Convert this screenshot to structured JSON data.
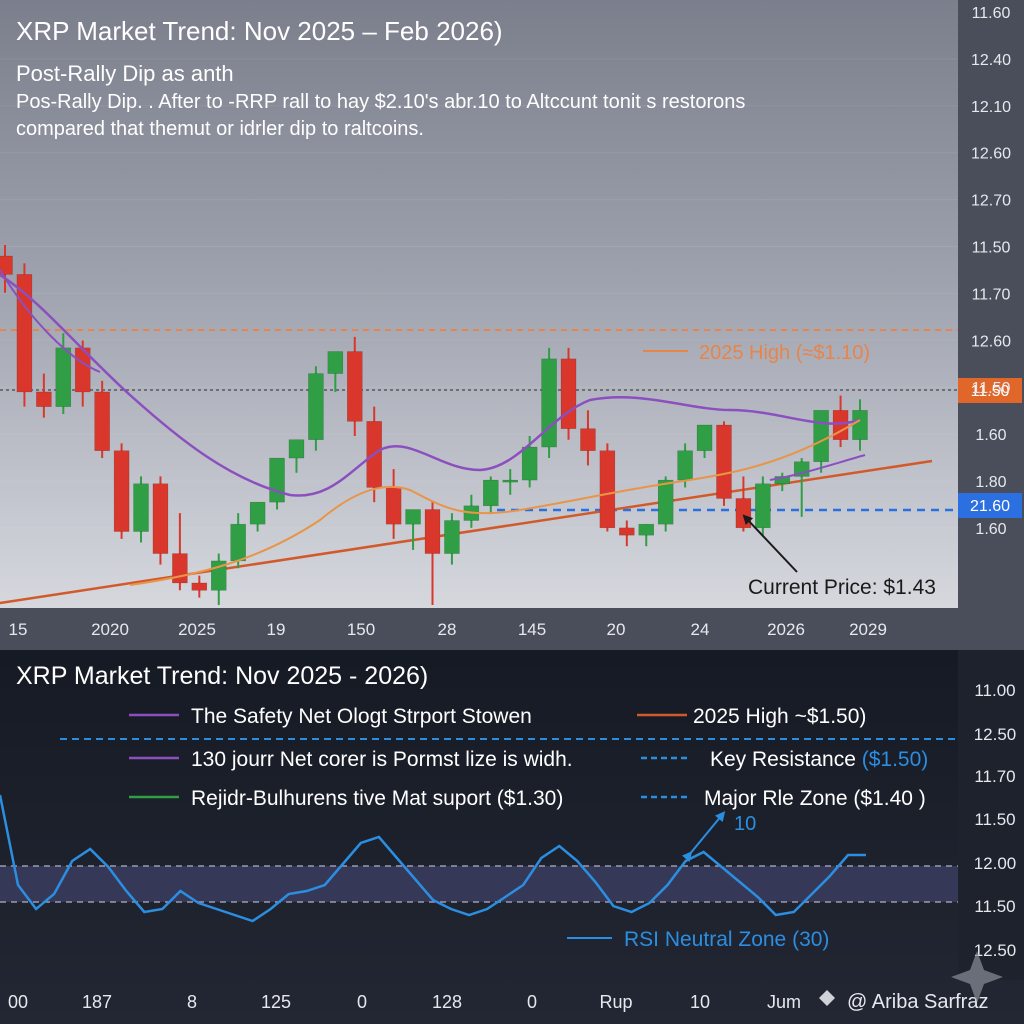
{
  "colors": {
    "up": "#2f9e44",
    "down": "#d9372b",
    "sma": "#8b4fc0",
    "ema": "#e8954a",
    "trend": "#d25a2a",
    "resistance": "#e8844a",
    "support": "#2b6fe0",
    "rsi": "#2b8ee0",
    "price_tag": "#e0662a",
    "support_tag": "#2b6fe0"
  },
  "header": {
    "title": "XRP Market Trend: Nov 2025 – Feb 2026)",
    "subtitle": "Post-Rally Dip as anth",
    "description_line1": "Pos-Rally Dip. . After to -RRP rall to hay $2.10's abr.10 to Altccunt tonit  s restorons",
    "description_line2": "compared that themut or idrler dip to raltcoins."
  },
  "chart_data": [
    {
      "type": "candlestick",
      "title": "XRP Market Trend: Nov 2025 – Feb 2026)",
      "x_tick_labels": [
        "15",
        "2020",
        "2025",
        "19",
        "150",
        "28",
        "145",
        "20",
        "24",
        "2026",
        "2029"
      ],
      "y_tick_labels": [
        "11.60",
        "12.40",
        "12.10",
        "12.60",
        "12.70",
        "11.50",
        "11.70",
        "12.60",
        "11.50",
        "1.60",
        "1.80",
        "1.60"
      ],
      "ohlc": [
        [
          93,
          96,
          83,
          88
        ],
        [
          88,
          91,
          52,
          56
        ],
        [
          56,
          61,
          49,
          52
        ],
        [
          52,
          72,
          50,
          68
        ],
        [
          68,
          70,
          52,
          56
        ],
        [
          56,
          59,
          38,
          40
        ],
        [
          40,
          42,
          16,
          18
        ],
        [
          18,
          33,
          15,
          31
        ],
        [
          31,
          33,
          9,
          12
        ],
        [
          12,
          23,
          2,
          4
        ],
        [
          4,
          6,
          0,
          2
        ],
        [
          2,
          12,
          -2,
          10
        ],
        [
          10,
          23,
          8,
          20
        ],
        [
          20,
          26,
          18,
          26
        ],
        [
          26,
          36,
          24,
          38
        ],
        [
          38,
          43,
          34,
          43
        ],
        [
          43,
          63,
          40,
          61
        ],
        [
          61,
          67,
          56,
          67
        ],
        [
          67,
          71,
          44,
          48
        ],
        [
          48,
          52,
          26,
          30
        ],
        [
          30,
          35,
          16,
          20
        ],
        [
          20,
          22,
          13,
          24
        ],
        [
          24,
          26,
          -2,
          12
        ],
        [
          12,
          23,
          9,
          21
        ],
        [
          21,
          28,
          19,
          25
        ],
        [
          25,
          33,
          23,
          32
        ],
        [
          32,
          35,
          28,
          32
        ],
        [
          32,
          44,
          30,
          41
        ],
        [
          41,
          68,
          38,
          65
        ],
        [
          65,
          68,
          43,
          46
        ],
        [
          46,
          51,
          36,
          40
        ],
        [
          40,
          42,
          18,
          19
        ],
        [
          19,
          21,
          14,
          17
        ],
        [
          17,
          20,
          14,
          20
        ],
        [
          20,
          33,
          18,
          32
        ],
        [
          32,
          42,
          30,
          40
        ],
        [
          40,
          47,
          38,
          47
        ],
        [
          47,
          48,
          25,
          27
        ],
        [
          27,
          33,
          18,
          19
        ],
        [
          19,
          33,
          17,
          31
        ],
        [
          31,
          34,
          29,
          33
        ],
        [
          33,
          38,
          22,
          37
        ],
        [
          37,
          48,
          34,
          51
        ],
        [
          51,
          55,
          41,
          43
        ],
        [
          43,
          54,
          40,
          51
        ]
      ],
      "sma_label": "The Safety Net Ologt Strport Stowen",
      "annotations": {
        "resistance_label": "2025 High (≈$1.10)",
        "current_price_label": "Current Price: $1.43",
        "price_tag": "11.50",
        "support_tag": "21.60"
      }
    },
    {
      "type": "line",
      "title": "XRP Market Trend: Nov 2025 - 2026)",
      "x_tick_labels": [
        "00",
        "187",
        "8",
        "125",
        "0",
        "128",
        "0",
        "Rup",
        "10",
        "Jum",
        "@ Ariba Sarfraz"
      ],
      "y_tick_labels": [
        "11.00",
        "12.50",
        "11.70",
        "11.50",
        "12.00",
        "11.50",
        "12.50"
      ],
      "series": [
        {
          "values": [
            1.6,
            1.3,
            1.22,
            1.27,
            1.38,
            1.42,
            1.36,
            1.28,
            1.21,
            1.22,
            1.28,
            1.24,
            1.22,
            1.2,
            1.18,
            1.22,
            1.27,
            1.28,
            1.3,
            1.37,
            1.44,
            1.46,
            1.39,
            1.32,
            1.25,
            1.22,
            1.2,
            1.22,
            1.26,
            1.3,
            1.39,
            1.43,
            1.38,
            1.31,
            1.23,
            1.21,
            1.24,
            1.3,
            1.38,
            1.41,
            1.36,
            1.31,
            1.26,
            1.2,
            1.21,
            1.27,
            1.33,
            1.4,
            1.4
          ]
        }
      ],
      "legend": [
        {
          "label": "The Safety Net Ologt Strport Stowen",
          "color": "#8b4fc0",
          "style": "solid"
        },
        {
          "label": "2025 High ~$1.50)",
          "color": "#d25a2a",
          "style": "solid"
        },
        {
          "label": "130 jourr Net corer is Pormst lize is widh.",
          "color": "#8b4fc0",
          "style": "solid"
        },
        {
          "label": "Key Resistance ",
          "value_label": "($1.50)",
          "color": "#2b8ee0",
          "style": "dashed"
        },
        {
          "label": "Rejidr-Bulhurens tive Mat suport ($1.30)",
          "color": "#2f9e44",
          "style": "solid"
        },
        {
          "label": "Major Rle Zone ($1.40 )",
          "color": "#2b8ee0",
          "style": "dashed"
        }
      ],
      "annotations": {
        "arrow_label": "10",
        "rsi_label": "RSI Neutral Zone (30)"
      }
    }
  ]
}
